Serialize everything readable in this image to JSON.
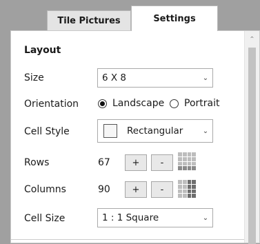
{
  "tabs": [
    {
      "label": "Tile Pictures",
      "active": false
    },
    {
      "label": "Settings",
      "active": true
    }
  ],
  "layout": {
    "section_title": "Layout",
    "size": {
      "label": "Size",
      "value": "6 X 8"
    },
    "orientation": {
      "label": "Orientation",
      "options": [
        {
          "label": "Landscape",
          "selected": true
        },
        {
          "label": "Portrait",
          "selected": false
        }
      ]
    },
    "cell_style": {
      "label": "Cell Style",
      "value": "Rectangular"
    },
    "rows": {
      "label": "Rows",
      "value": "67",
      "plus": "+",
      "minus": "-"
    },
    "columns": {
      "label": "Columns",
      "value": "90",
      "plus": "+",
      "minus": "-"
    },
    "cell_size": {
      "label": "Cell Size",
      "value": "1 : 1 Square"
    }
  },
  "icons": {
    "dropdown": "chevron-down-icon",
    "scroll_up": "chevron-up-icon",
    "rows_grid": "grid-rows-icon",
    "columns_grid": "grid-columns-icon",
    "cell_style_swatch": "square-swatch-icon"
  },
  "colors": {
    "background": "#a0a0a0",
    "panel": "#ffffff",
    "button": "#e8e8e8",
    "inactive_tab": "#e4e4e4"
  }
}
